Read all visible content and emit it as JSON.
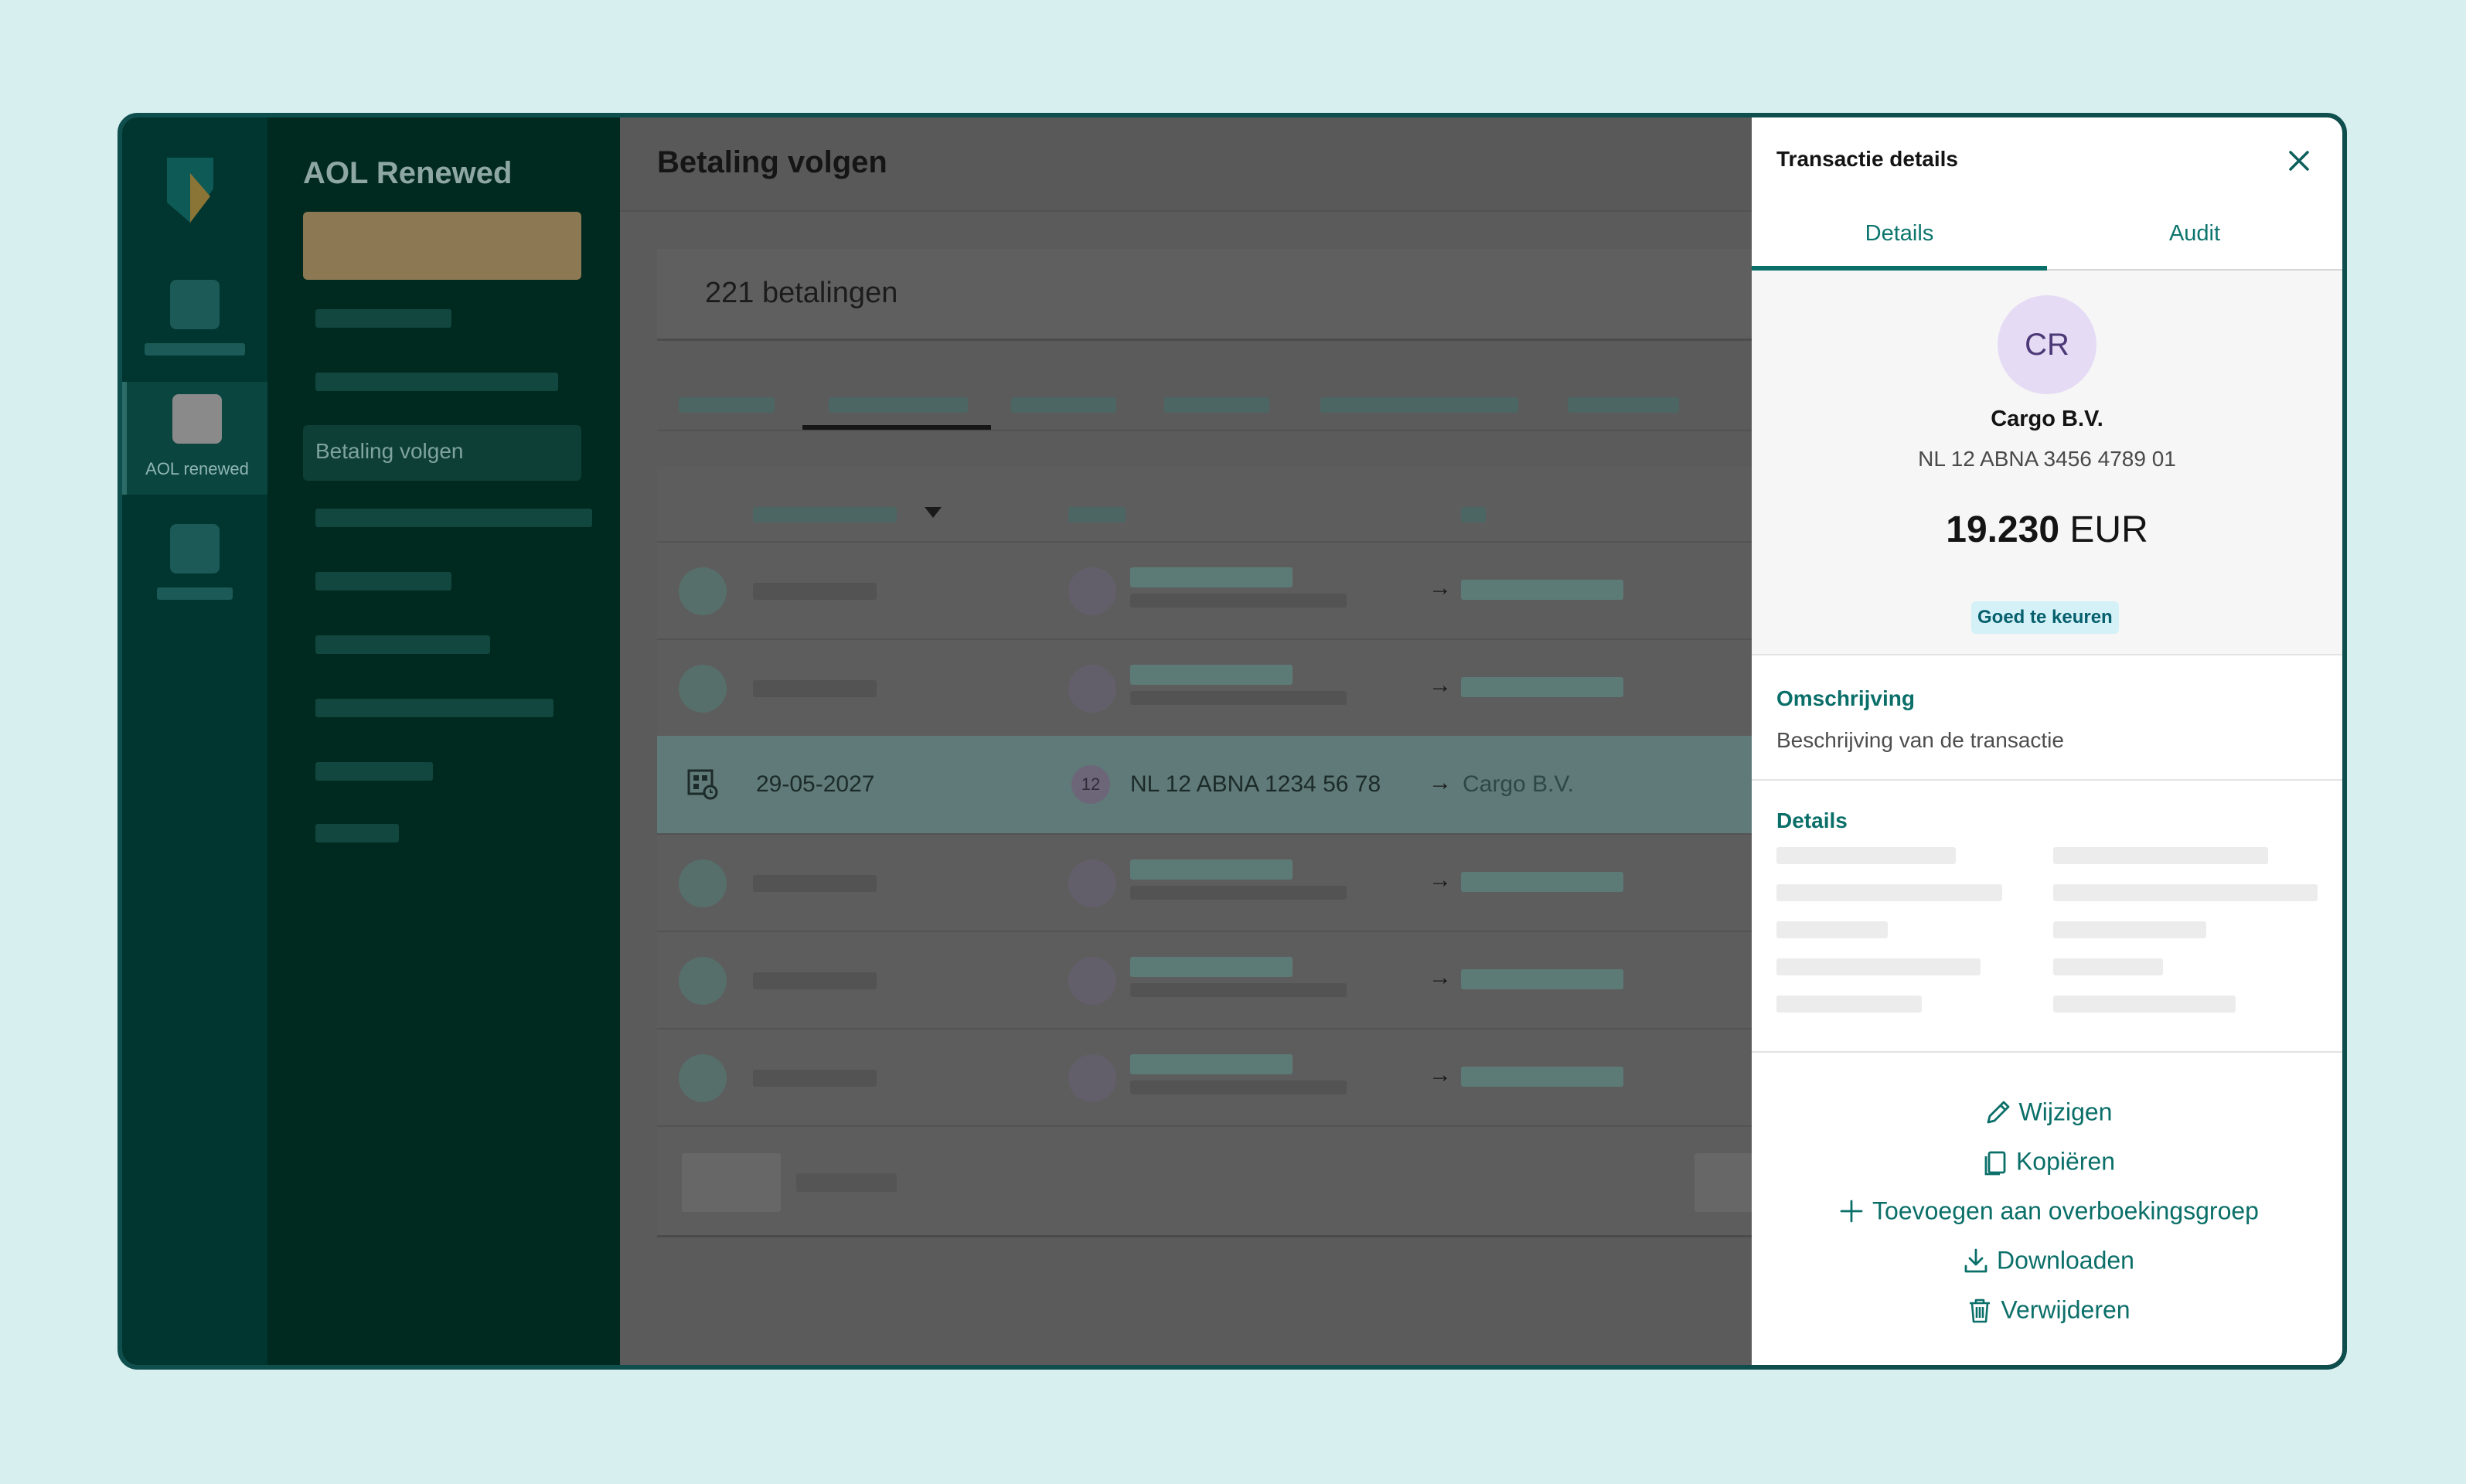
{
  "app": {
    "name": "AOL Renewed",
    "rail_active_label": "AOL renewed",
    "sidebar_active_item": "Betaling volgen"
  },
  "main": {
    "title": "Betaling volgen",
    "count_label": "221 betalingen",
    "highlighted_row": {
      "date": "29-05-2027",
      "avatar_badge": "12",
      "from_account": "NL 12 ABNA 1234 56 78",
      "to": "Cargo B.V."
    }
  },
  "panel": {
    "title": "Transactie details",
    "tabs": [
      "Details",
      "Audit"
    ],
    "active_tab": "Details",
    "counterparty": {
      "initials": "CR",
      "name": "Cargo B.V.",
      "iban": "NL 12 ABNA 3456 4789 01"
    },
    "amount": {
      "value": "19.230",
      "currency": "EUR"
    },
    "status": "Goed te keuren",
    "description": {
      "title": "Omschrijving",
      "text": "Beschrijving van de transactie"
    },
    "details_title": "Details",
    "actions": {
      "edit": "Wijzigen",
      "copy": "Kopiëren",
      "add_group": "Toevoegen aan overboekingsgroep",
      "download": "Downloaden",
      "delete": "Verwijderen"
    }
  },
  "colors": {
    "brand_teal": "#0b6f69",
    "rail_dark": "#003530",
    "status_bg": "#d3f1f6",
    "avatar_bg": "#e6dbf5"
  }
}
